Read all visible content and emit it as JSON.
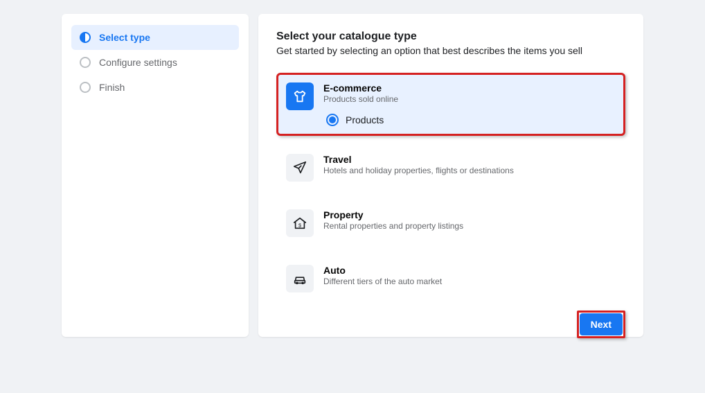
{
  "sidebar": {
    "steps": [
      {
        "label": "Select type"
      },
      {
        "label": "Configure settings"
      },
      {
        "label": "Finish"
      }
    ]
  },
  "main": {
    "title": "Select your catalogue type",
    "subtitle": "Get started by selecting an option that best describes the items you sell",
    "options": [
      {
        "title": "E-commerce",
        "desc": "Products sold online",
        "sub": "Products"
      },
      {
        "title": "Travel",
        "desc": "Hotels and holiday properties, flights or destinations"
      },
      {
        "title": "Property",
        "desc": "Rental properties and property listings"
      },
      {
        "title": "Auto",
        "desc": "Different tiers of the auto market"
      }
    ],
    "next": "Next"
  }
}
